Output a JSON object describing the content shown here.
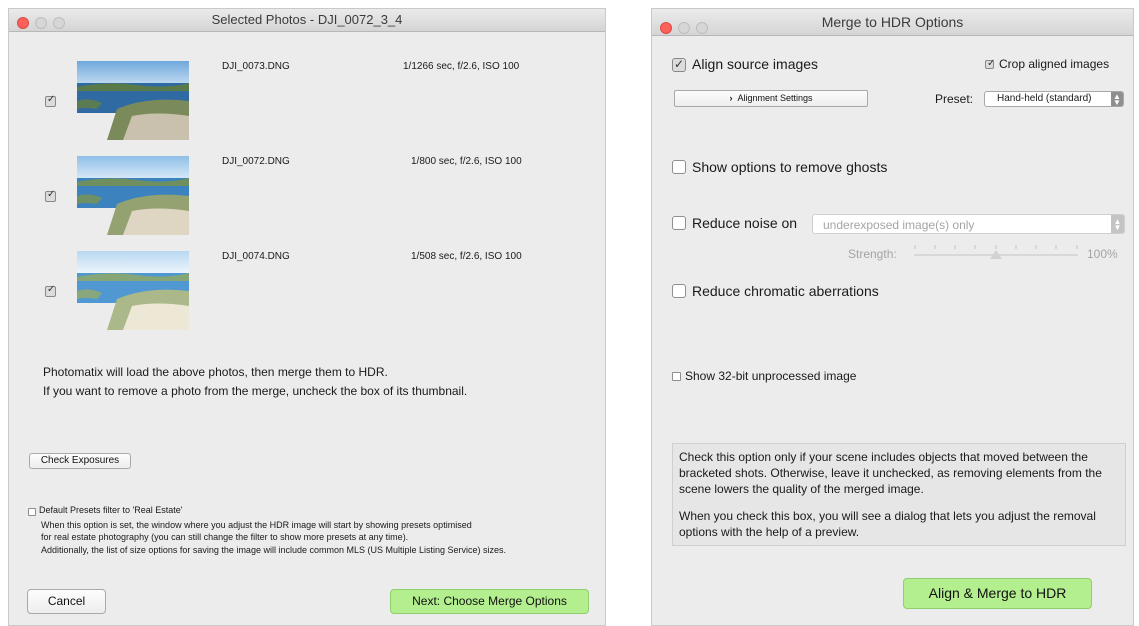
{
  "left_window": {
    "title": "Selected Photos - DJI_0072_3_4",
    "photos": [
      {
        "filename": "DJI_0073.DNG",
        "exposure": "1/1266 sec, f/2.6, ISO 100",
        "checked": true
      },
      {
        "filename": "DJI_0072.DNG",
        "exposure": "1/800 sec, f/2.6, ISO 100",
        "checked": true
      },
      {
        "filename": "DJI_0074.DNG",
        "exposure": "1/508 sec, f/2.6, ISO 100",
        "checked": true
      }
    ],
    "info_line1": "Photomatix will load the above photos, then merge them to HDR.",
    "info_line2": "If you want to remove a photo from the merge, uncheck the box of its thumbnail.",
    "check_exposures_label": "Check Exposures",
    "default_presets_label": "Default Presets filter to 'Real Estate'",
    "presets_desc1": "When this option is set, the window where you adjust the HDR image will start by showing presets optimised",
    "presets_desc2": "for real estate photography (you can still change the filter to show more presets at any time).",
    "presets_desc3": "Additionally, the list of size options for saving the image will include common MLS (US Multiple Listing Service) sizes.",
    "cancel_label": "Cancel",
    "next_label": "Next: Choose Merge Options"
  },
  "right_window": {
    "title": "Merge to HDR Options",
    "align_label": "Align source images",
    "crop_label": "Crop aligned images",
    "alignment_settings_label": "Alignment Settings",
    "preset_label": "Preset:",
    "preset_value": "Hand-held (standard)",
    "ghosts_label": "Show options to remove ghosts",
    "noise_label": "Reduce noise on",
    "noise_select_value": "underexposed image(s) only",
    "strength_label": "Strength:",
    "strength_value": "100%",
    "strength_level": 0.5,
    "chromatic_label": "Reduce chromatic aberrations",
    "show32_label": "Show 32-bit unprocessed image",
    "help_para1": "Check this option only if your scene includes objects that moved between the bracketed shots. Otherwise, leave it unchecked, as removing elements from the scene lowers the quality of the merged image.",
    "help_para2": "When you check this box, you will see a dialog that lets you adjust the removal options with the help of a preview.",
    "merge_button_label": "Align & Merge to HDR"
  },
  "colors": {
    "green_button": "#b3ef8f",
    "close_red": "#fc605b"
  }
}
